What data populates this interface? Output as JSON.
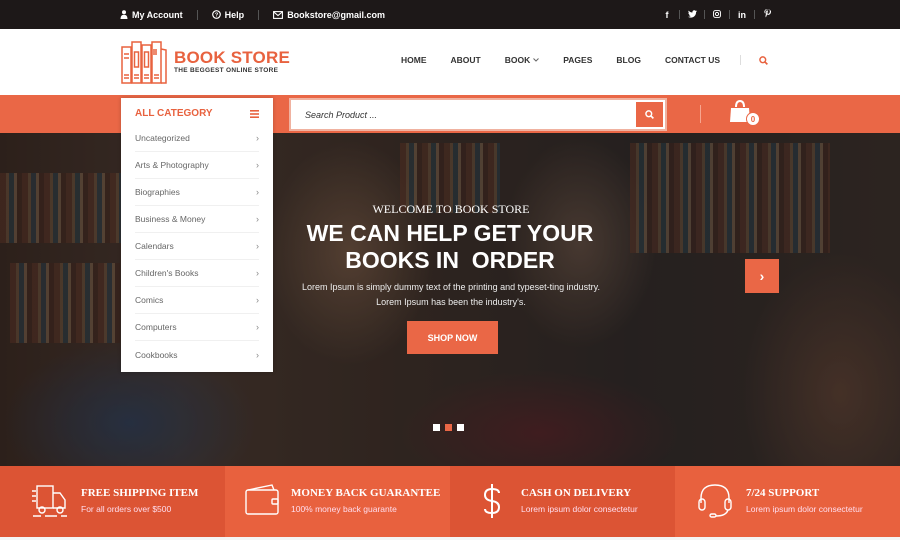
{
  "topbar": {
    "links": [
      {
        "label": "My Account",
        "icon": "user-icon"
      },
      {
        "label": "Help",
        "icon": "help-icon"
      },
      {
        "label": "Bookstore@gmail.com",
        "icon": "mail-icon"
      }
    ],
    "social": [
      {
        "glyph": "f",
        "icon": "facebook-icon"
      },
      {
        "glyph": "🐦",
        "icon": "twitter-icon"
      },
      {
        "glyph": "◎",
        "icon": "instagram-icon"
      },
      {
        "glyph": "in",
        "icon": "linkedin-icon"
      },
      {
        "glyph": "℘",
        "icon": "pinterest-icon"
      }
    ]
  },
  "header": {
    "logo_title": "BOOK STORE",
    "logo_subtitle": "THE BEGGEST ONLINE STORE",
    "nav": [
      {
        "label": "HOME"
      },
      {
        "label": "ABOUT"
      },
      {
        "label": "BOOK",
        "has_dropdown": true,
        "caret": "⌄"
      },
      {
        "label": "PAGES"
      },
      {
        "label": "BLOG"
      },
      {
        "label": "CONTACT US"
      }
    ]
  },
  "category": {
    "title": "ALL CATEGORY",
    "chevron": "›",
    "items": [
      {
        "label": "Uncategorized"
      },
      {
        "label": "Arts & Photography"
      },
      {
        "label": "Biographies"
      },
      {
        "label": "Business & Money"
      },
      {
        "label": "Calendars"
      },
      {
        "label": "Children's Books"
      },
      {
        "label": "Comics"
      },
      {
        "label": "Computers"
      },
      {
        "label": "Cookbooks"
      }
    ]
  },
  "search": {
    "placeholder": "Search Product ..."
  },
  "cart": {
    "count": "0"
  },
  "hero": {
    "welcome": "WELCOME TO BOOK STORE",
    "title_line1": "WE CAN HELP GET YOUR",
    "title_line2": "BOOKS IN  ORDER",
    "description": "Lorem Ipsum is simply dummy text of the printing and typeset-ting industry. Lorem Ipsum has been the industry's.",
    "cta_label": "SHOP NOW",
    "next_glyph": "›",
    "slides_total": 3,
    "active_slide": 2
  },
  "features": [
    {
      "title": "FREE SHIPPING ITEM",
      "subtitle": "For all orders over $500",
      "icon": "truck-icon"
    },
    {
      "title": "MONEY BACK GUARANTEE",
      "subtitle": "100% money back guarante",
      "icon": "wallet-icon"
    },
    {
      "title": "CASH ON DELIVERY",
      "subtitle": "Lorem ipsum dolor consectetur",
      "icon": "dollar-icon"
    },
    {
      "title": "7/24 SUPPORT",
      "subtitle": "Lorem ipsum dolor consectetur",
      "icon": "headset-icon"
    }
  ],
  "colors": {
    "accent": "#ea6746",
    "topbar_bg": "#1d1818",
    "feature_dark": "#dc5434",
    "feature_light": "#e8613e"
  }
}
